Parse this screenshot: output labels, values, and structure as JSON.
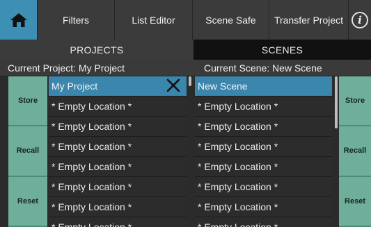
{
  "toolbar": {
    "home_icon": "home-icon",
    "filters": "Filters",
    "list_editor": "List Editor",
    "scene_safe": "Scene Safe",
    "transfer_project": "Transfer Project",
    "info_icon": "info-icon",
    "info_glyph": "i",
    "accent_color": "#3d8fb3"
  },
  "sections": {
    "projects": "PROJECTS",
    "scenes": "SCENES"
  },
  "current": {
    "project": "Current Project: My Project",
    "scene": "Current Scene:  New Scene"
  },
  "left_buttons": [
    "Store",
    "Recall",
    "Reset"
  ],
  "right_buttons": [
    "Store",
    "Recall",
    "Reset"
  ],
  "projects_list": [
    "My Project",
    "* Empty Location *",
    "* Empty Location *",
    "* Empty Location *",
    "* Empty Location *",
    "* Empty Location *",
    "* Empty Location *",
    "* Empty Location *"
  ],
  "scenes_list": [
    "New Scene",
    "* Empty Location *",
    "* Empty Location *",
    "* Empty Location *",
    "* Empty Location *",
    "* Empty Location *",
    "* Empty Location *",
    "* Empty Location *"
  ],
  "colors": {
    "selected_row": "#3a86ad",
    "side_button": "#6fae9a"
  }
}
